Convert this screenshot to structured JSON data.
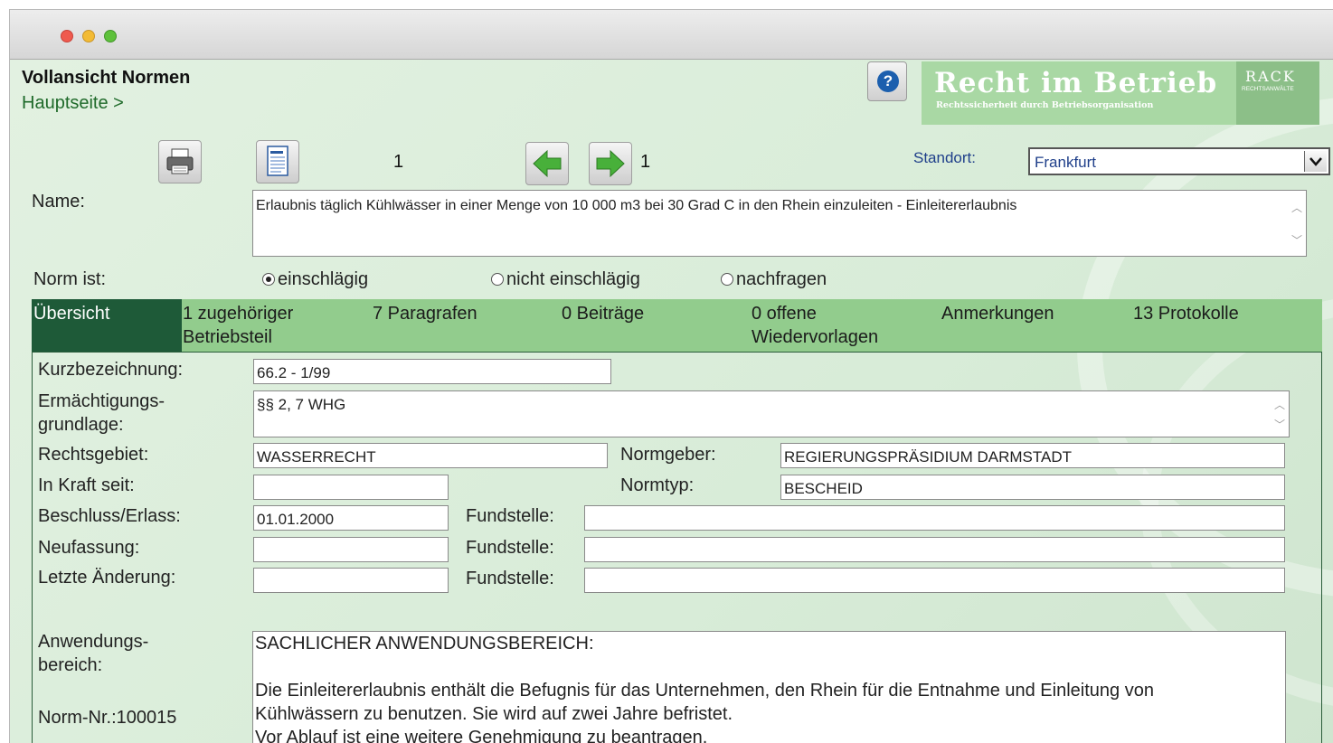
{
  "window": {
    "controls": [
      "close",
      "minimize",
      "zoom"
    ]
  },
  "header": {
    "title": "Vollansicht Normen",
    "breadcrumb": "Hauptseite >",
    "help_icon": "help-icon",
    "logo_main": "Recht im Betrieb",
    "logo_sub": "Rechtssicherheit durch Betriebsorganisation",
    "logo_rack": "RACK",
    "logo_rack_sub": "RECHTSANWÄLTE"
  },
  "toolbar": {
    "print_icon": "printer-icon",
    "document_icon": "document-icon",
    "page_current": "1",
    "prev_icon": "arrow-left-icon",
    "next_icon": "arrow-right-icon",
    "page_total": "1",
    "standort_label": "Standort:",
    "standort_value": "Frankfurt"
  },
  "name": {
    "label": "Name:",
    "value": "Erlaubnis täglich Kühlwässer in einer Menge von 10 000 m3 bei 30 Grad C in den Rhein einzuleiten - Einleitererlaubnis"
  },
  "norm_ist": {
    "label": "Norm ist:",
    "options": [
      {
        "label": "einschlägig",
        "selected": true
      },
      {
        "label": "nicht einschlägig",
        "selected": false
      },
      {
        "label": "nachfragen",
        "selected": false
      }
    ]
  },
  "tabs": [
    {
      "label": "Übersicht",
      "active": true
    },
    {
      "label": "1 zugehöriger Betriebsteil"
    },
    {
      "label": "7 Paragrafen"
    },
    {
      "label": "0 Beiträge"
    },
    {
      "label": "0 offene Wiedervorlagen"
    },
    {
      "label": "Anmerkungen"
    },
    {
      "label": "13 Protokolle"
    }
  ],
  "form": {
    "kurzbezeichnung": {
      "label": "Kurzbezeichnung:",
      "value": "66.2 - 1/99"
    },
    "ermaechtigung": {
      "label_line1": "Ermächtigungs-",
      "label_line2": "grundlage:",
      "value": "§§ 2, 7 WHG"
    },
    "rechtsgebiet": {
      "label": "Rechtsgebiet:",
      "value": "WASSERRECHT"
    },
    "normgeber": {
      "label": "Normgeber:",
      "value": "REGIERUNGSPRÄSIDIUM DARMSTADT"
    },
    "in_kraft": {
      "label": "In Kraft seit:",
      "value": ""
    },
    "normtyp": {
      "label": "Normtyp:",
      "value": "BESCHEID"
    },
    "beschluss": {
      "label": "Beschluss/Erlass:",
      "value": "01.01.2000",
      "fundstelle_label": "Fundstelle:",
      "fundstelle_value": ""
    },
    "neufassung": {
      "label": "Neufassung:",
      "value": "",
      "fundstelle_label": "Fundstelle:",
      "fundstelle_value": ""
    },
    "letzte_aenderung": {
      "label": "Letzte Änderung:",
      "value": "",
      "fundstelle_label": "Fundstelle:",
      "fundstelle_value": ""
    },
    "anwendung": {
      "label_line1": "Anwendungs-",
      "label_line2": "bereich:",
      "lines": [
        "SACHLICHER ANWENDUNGSBEREICH:",
        "Die Einleitererlaubnis enthält die Befugnis für das Unternehmen, den Rhein für die Entnahme und Einleitung von",
        "Kühlwässern zu benutzen. Sie wird auf zwei Jahre befristet.",
        "Vor Ablauf ist eine weitere Genehmigung zu beantragen."
      ]
    },
    "norm_nr": "Norm-Nr.:100015"
  }
}
